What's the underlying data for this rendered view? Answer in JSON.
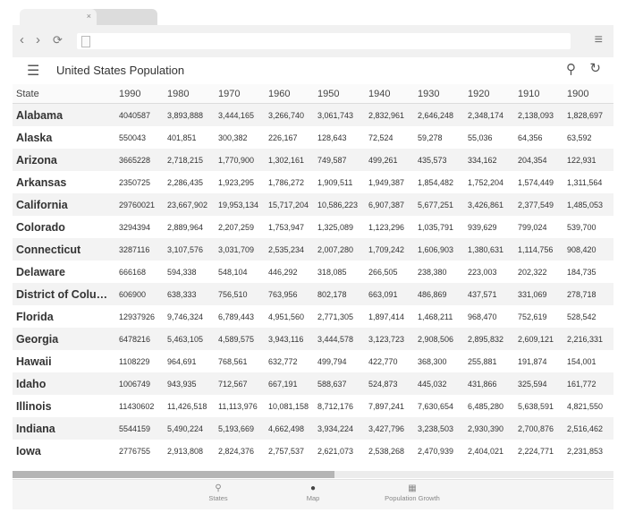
{
  "app": {
    "title": "United States Population"
  },
  "table": {
    "columns": [
      "State",
      "1990",
      "1980",
      "1970",
      "1960",
      "1950",
      "1940",
      "1930",
      "1920",
      "1910",
      "1900"
    ],
    "rows": [
      [
        "Alabama",
        "4040587",
        "3,893,888",
        "3,444,165",
        "3,266,740",
        "3,061,743",
        "2,832,961",
        "2,646,248",
        "2,348,174",
        "2,138,093",
        "1,828,697"
      ],
      [
        "Alaska",
        "550043",
        "401,851",
        "300,382",
        "226,167",
        "128,643",
        "72,524",
        "59,278",
        "55,036",
        "64,356",
        "63,592"
      ],
      [
        "Arizona",
        "3665228",
        "2,718,215",
        "1,770,900",
        "1,302,161",
        "749,587",
        "499,261",
        "435,573",
        "334,162",
        "204,354",
        "122,931"
      ],
      [
        "Arkansas",
        "2350725",
        "2,286,435",
        "1,923,295",
        "1,786,272",
        "1,909,511",
        "1,949,387",
        "1,854,482",
        "1,752,204",
        "1,574,449",
        "1,311,564"
      ],
      [
        "California",
        "29760021",
        "23,667,902",
        "19,953,134",
        "15,717,204",
        "10,586,223",
        "6,907,387",
        "5,677,251",
        "3,426,861",
        "2,377,549",
        "1,485,053"
      ],
      [
        "Colorado",
        "3294394",
        "2,889,964",
        "2,207,259",
        "1,753,947",
        "1,325,089",
        "1,123,296",
        "1,035,791",
        "939,629",
        "799,024",
        "539,700"
      ],
      [
        "Connecticut",
        "3287116",
        "3,107,576",
        "3,031,709",
        "2,535,234",
        "2,007,280",
        "1,709,242",
        "1,606,903",
        "1,380,631",
        "1,114,756",
        "908,420"
      ],
      [
        "Delaware",
        "666168",
        "594,338",
        "548,104",
        "446,292",
        "318,085",
        "266,505",
        "238,380",
        "223,003",
        "202,322",
        "184,735"
      ],
      [
        "District of Columbia",
        "606900",
        "638,333",
        "756,510",
        "763,956",
        "802,178",
        "663,091",
        "486,869",
        "437,571",
        "331,069",
        "278,718"
      ],
      [
        "Florida",
        "12937926",
        "9,746,324",
        "6,789,443",
        "4,951,560",
        "2,771,305",
        "1,897,414",
        "1,468,211",
        "968,470",
        "752,619",
        "528,542"
      ],
      [
        "Georgia",
        "6478216",
        "5,463,105",
        "4,589,575",
        "3,943,116",
        "3,444,578",
        "3,123,723",
        "2,908,506",
        "2,895,832",
        "2,609,121",
        "2,216,331"
      ],
      [
        "Hawaii",
        "1108229",
        "964,691",
        "768,561",
        "632,772",
        "499,794",
        "422,770",
        "368,300",
        "255,881",
        "191,874",
        "154,001"
      ],
      [
        "Idaho",
        "1006749",
        "943,935",
        "712,567",
        "667,191",
        "588,637",
        "524,873",
        "445,032",
        "431,866",
        "325,594",
        "161,772"
      ],
      [
        "Illinois",
        "11430602",
        "11,426,518",
        "11,113,976",
        "10,081,158",
        "8,712,176",
        "7,897,241",
        "7,630,654",
        "6,485,280",
        "5,638,591",
        "4,821,550"
      ],
      [
        "Indiana",
        "5544159",
        "5,490,224",
        "5,193,669",
        "4,662,498",
        "3,934,224",
        "3,427,796",
        "3,238,503",
        "2,930,390",
        "2,700,876",
        "2,516,462"
      ],
      [
        "Iowa",
        "2776755",
        "2,913,808",
        "2,824,376",
        "2,757,537",
        "2,621,073",
        "2,538,268",
        "2,470,939",
        "2,404,021",
        "2,224,771",
        "2,231,853"
      ]
    ]
  },
  "bottom_nav": {
    "items": [
      {
        "label": "States",
        "icon": "pin-icon"
      },
      {
        "label": "Map",
        "icon": "map-marker-icon"
      },
      {
        "label": "Population Growth",
        "icon": "bar-chart-icon"
      }
    ]
  },
  "icons": {
    "back": "‹",
    "forward": "›",
    "reload": "⟳",
    "browser_menu": "≡",
    "tab_close": "×",
    "hamburger": "☰",
    "search": "⚲",
    "refresh": "↻",
    "states": "⚲",
    "map": "●",
    "growth": "▦"
  }
}
